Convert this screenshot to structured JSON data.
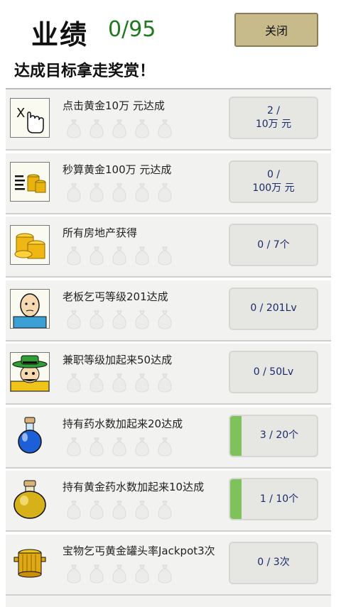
{
  "header": {
    "title": "业绩",
    "count": "0/95",
    "close_label": "关闭",
    "subtitle": "达成目标拿走奖赏！"
  },
  "rows": [
    {
      "label": "点击黄金10万 元达成",
      "progress_line1": "2 /",
      "progress_line2": "10万 元",
      "icon": "tap-hand-icon",
      "filled": false
    },
    {
      "label": "秒算黄金100万 元达成",
      "progress_line1": "0 /",
      "progress_line2": "100万 元",
      "icon": "coin-stack-icon",
      "filled": false
    },
    {
      "label": "所有房地产获得",
      "progress_line1": "0 / 7个",
      "progress_line2": "",
      "icon": "gold-coins-icon",
      "filled": false
    },
    {
      "label": "老板乞丐等级201达成",
      "progress_line1": "0 / 201Lv",
      "progress_line2": "",
      "icon": "bald-man-icon",
      "filled": false
    },
    {
      "label": "兼职等级加起来50达成",
      "progress_line1": "0 / 50Lv",
      "progress_line2": "",
      "icon": "green-hat-man-icon",
      "filled": false
    },
    {
      "label": "持有药水数加起来20达成",
      "progress_line1": "3 / 20个",
      "progress_line2": "",
      "icon": "blue-potion-icon",
      "filled": true,
      "progress": 0.15
    },
    {
      "label": "持有黄金药水数加起来10达成",
      "progress_line1": "1 / 10个",
      "progress_line2": "",
      "icon": "gold-potion-icon",
      "filled": true,
      "progress": 0.1
    },
    {
      "label": "宝物乞丐黄金罐头率Jackpot3次",
      "progress_line1": "0 / 3次",
      "progress_line2": "",
      "icon": "gold-pot-icon",
      "filled": false
    }
  ]
}
